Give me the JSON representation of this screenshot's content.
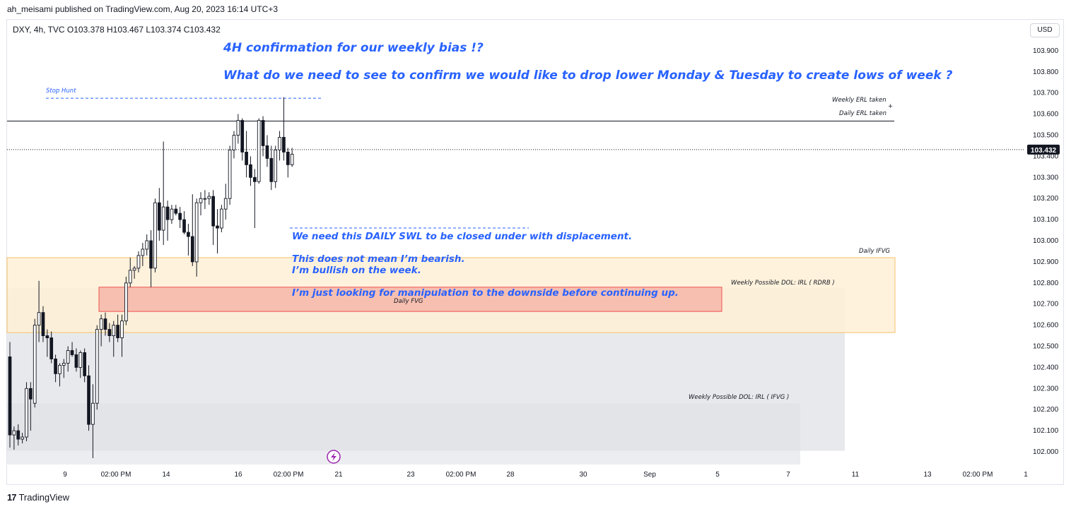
{
  "header": {
    "published": "ah_meisami published on TradingView.com, Aug 20, 2023 16:14 UTC+3"
  },
  "symbol_line": "DXY, 4h, TVC  O103.378  H103.467  L103.374  C103.432",
  "currency_button": "USD",
  "footer": {
    "brand": "TradingView",
    "logo": "17"
  },
  "colors": {
    "up": "#ffffff",
    "down": "#131722",
    "note": "#2962ff",
    "ifvg_zone": "#fff0d6",
    "fvg_zone": "#f4b6a8",
    "dol_zone": "#e6e7ea",
    "price_tag": "#131722"
  },
  "annotations": {
    "title1": "4H confirmation for our weekly bias !?",
    "title2": "What do we need to see to confirm we would like to drop lower Monday & Tuesday to create lows of week ?",
    "body1": "We need this DAILY SWL to be closed under with displacement.",
    "body2": "This does not mean I’m bearish.",
    "body3": "I’m bullish on the week.",
    "body4": "I’m just looking for manipulation to the downside before continuing up.",
    "stop_hunt": "Stop Hunt",
    "weekly_erl": "Weekly ERL taken",
    "plus": "+",
    "daily_erl": "Daily ERL taken",
    "daily_ifvg": "Daily IFVG",
    "weekly_rdrb": "Weekly Possible DOL: IRL ( RDRB )",
    "daily_fvg": "Daily FVG",
    "weekly_ifvg": "Weekly Possible DOL: IRL ( IFVG )"
  },
  "chart_data": {
    "type": "candlestick",
    "symbol": "DXY",
    "timeframe": "4h",
    "exchange": "TVC",
    "ohlc_current": {
      "open": 103.378,
      "high": 103.467,
      "low": 103.374,
      "close": 103.432
    },
    "last_price_label": "103.432",
    "ylim": [
      101.94,
      103.98
    ],
    "y_ticks": [
      "103.900",
      "103.800",
      "103.700",
      "103.600",
      "103.500",
      "103.400",
      "103.300",
      "103.200",
      "103.100",
      "103.000",
      "102.900",
      "102.800",
      "102.700",
      "102.600",
      "102.500",
      "102.400",
      "102.300",
      "102.200",
      "102.100",
      "102.000"
    ],
    "x_ticks": [
      "9",
      "02:00 PM",
      "14",
      "16",
      "02:00 PM",
      "21",
      "23",
      "02:00 PM",
      "28",
      "30",
      "Sep",
      "5",
      "7",
      "11",
      "13",
      "02:00 PM",
      "1"
    ],
    "candles": [
      [
        102.45,
        102.52,
        102.02,
        102.08
      ],
      [
        102.08,
        102.12,
        102.01,
        102.1
      ],
      [
        102.1,
        102.13,
        102.03,
        102.06
      ],
      [
        102.06,
        102.09,
        102.04,
        102.07
      ],
      [
        102.07,
        102.33,
        102.05,
        102.3
      ],
      [
        102.3,
        102.33,
        102.1,
        102.25
      ],
      [
        102.23,
        102.63,
        102.21,
        102.6
      ],
      [
        102.6,
        102.81,
        102.52,
        102.66
      ],
      [
        102.66,
        102.69,
        102.52,
        102.55
      ],
      [
        102.55,
        102.58,
        102.45,
        102.54
      ],
      [
        102.54,
        102.57,
        102.42,
        102.44
      ],
      [
        102.44,
        102.46,
        102.33,
        102.37
      ],
      [
        102.37,
        102.42,
        102.31,
        102.41
      ],
      [
        102.41,
        102.44,
        102.35,
        102.42
      ],
      [
        102.42,
        102.5,
        102.38,
        102.48
      ],
      [
        102.48,
        102.52,
        102.45,
        102.46
      ],
      [
        102.46,
        102.49,
        102.38,
        102.4
      ],
      [
        102.4,
        102.48,
        102.35,
        102.47
      ],
      [
        102.47,
        102.49,
        102.33,
        102.36
      ],
      [
        102.36,
        102.41,
        102.1,
        102.13
      ],
      [
        102.13,
        102.32,
        101.97,
        102.23
      ],
      [
        102.23,
        102.6,
        102.2,
        102.58
      ],
      [
        102.58,
        102.65,
        102.5,
        102.63
      ],
      [
        102.63,
        102.66,
        102.55,
        102.58
      ],
      [
        102.58,
        102.61,
        102.52,
        102.55
      ],
      [
        102.55,
        102.62,
        102.45,
        102.6
      ],
      [
        102.6,
        102.65,
        102.52,
        102.54
      ],
      [
        102.54,
        102.65,
        102.45,
        102.62
      ],
      [
        102.62,
        102.83,
        102.6,
        102.8
      ],
      [
        102.8,
        102.92,
        102.78,
        102.86
      ],
      [
        102.86,
        102.88,
        102.82,
        102.87
      ],
      [
        102.87,
        102.95,
        102.85,
        102.93
      ],
      [
        102.93,
        102.99,
        102.88,
        102.96
      ],
      [
        102.96,
        103.03,
        102.93,
        103.0
      ],
      [
        103.0,
        103.05,
        102.78,
        102.87
      ],
      [
        102.87,
        103.2,
        102.85,
        103.18
      ],
      [
        103.18,
        103.25,
        103.0,
        103.05
      ],
      [
        103.05,
        103.47,
        102.98,
        103.16
      ],
      [
        103.16,
        103.19,
        103.0,
        103.1
      ],
      [
        103.1,
        103.17,
        103.08,
        103.15
      ],
      [
        103.15,
        103.17,
        103.12,
        103.13
      ],
      [
        103.13,
        103.16,
        103.06,
        103.1
      ],
      [
        103.1,
        103.14,
        103.03,
        103.04
      ],
      [
        103.04,
        103.08,
        102.93,
        103.02
      ],
      [
        103.02,
        103.22,
        102.88,
        102.9
      ],
      [
        102.9,
        103.2,
        102.83,
        103.18
      ],
      [
        103.18,
        103.23,
        103.12,
        103.2
      ],
      [
        103.2,
        103.24,
        103.15,
        103.2
      ],
      [
        103.2,
        103.23,
        103.17,
        103.21
      ],
      [
        103.21,
        103.24,
        102.98,
        103.07
      ],
      [
        103.07,
        103.15,
        102.94,
        103.06
      ],
      [
        103.06,
        103.17,
        103.04,
        103.15
      ],
      [
        103.15,
        103.27,
        103.1,
        103.2
      ],
      [
        103.2,
        103.45,
        103.17,
        103.43
      ],
      [
        103.43,
        103.52,
        103.39,
        103.5
      ],
      [
        103.5,
        103.6,
        103.46,
        103.57
      ],
      [
        103.57,
        103.58,
        103.38,
        103.42
      ],
      [
        103.42,
        103.52,
        103.3,
        103.36
      ],
      [
        103.36,
        103.4,
        103.26,
        103.3
      ],
      [
        103.3,
        103.34,
        103.06,
        103.28
      ],
      [
        103.28,
        103.58,
        103.27,
        103.57
      ],
      [
        103.57,
        103.59,
        103.4,
        103.45
      ],
      [
        103.45,
        103.5,
        103.35,
        103.39
      ],
      [
        103.39,
        103.45,
        103.24,
        103.28
      ],
      [
        103.28,
        103.45,
        103.25,
        103.43
      ],
      [
        103.43,
        103.52,
        103.38,
        103.49
      ],
      [
        103.49,
        103.68,
        103.38,
        103.42
      ],
      [
        103.42,
        103.44,
        103.3,
        103.36
      ],
      [
        103.36,
        103.44,
        103.35,
        103.41
      ]
    ]
  }
}
